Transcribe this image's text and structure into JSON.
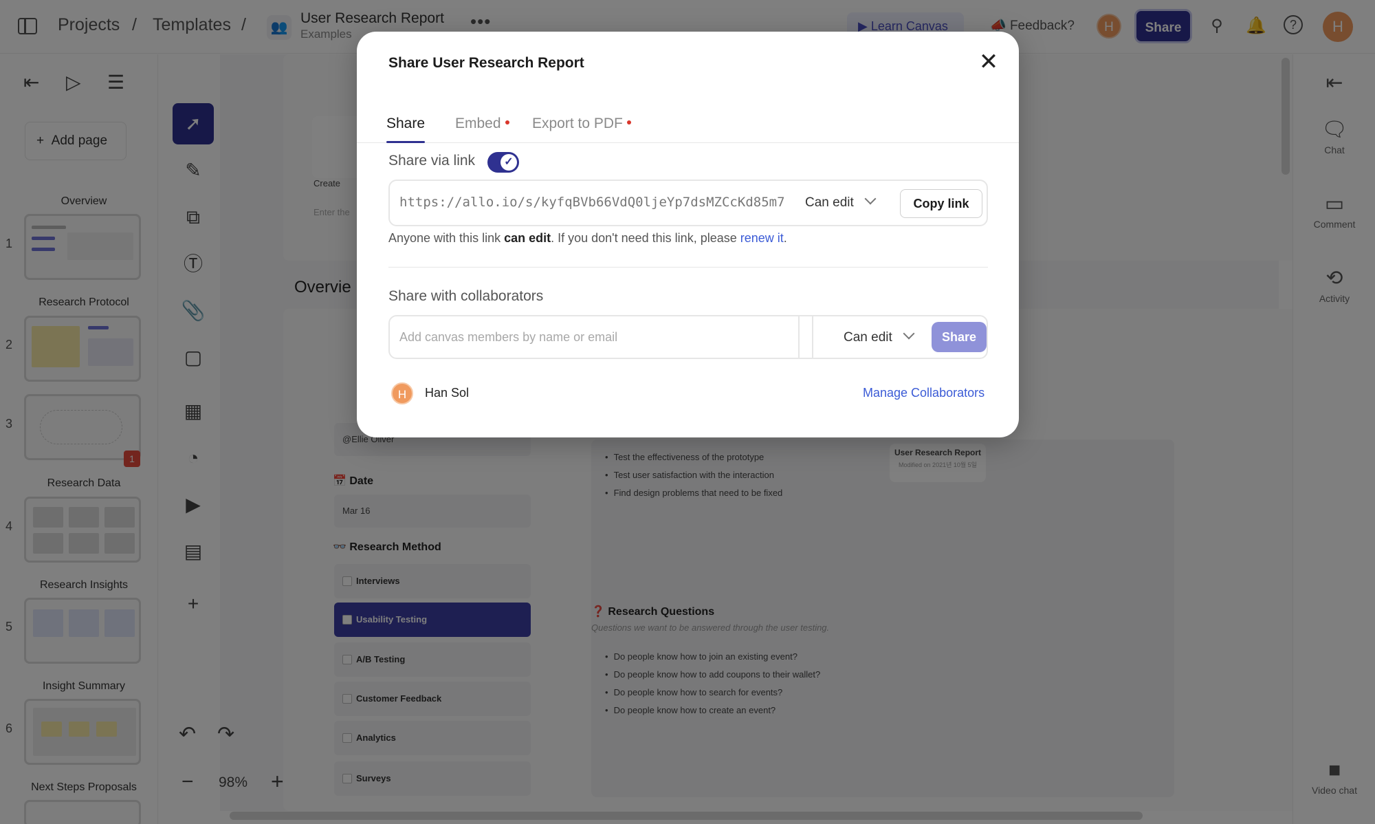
{
  "topbar": {
    "crumbs": [
      "Projects",
      "Templates"
    ],
    "separator": "/",
    "doc_icon": "👥",
    "doc_title": "User Research Report",
    "doc_subtitle": "Examples",
    "more": "•••",
    "learn_label": "Learn Canvas",
    "feedback_label": "Feedback?",
    "avatar_initial": "H",
    "share_label": "Share"
  },
  "sidebar": {
    "add_page_label": "Add page",
    "pages": [
      {
        "num": "1",
        "label": "Overview"
      },
      {
        "num": "2",
        "label": "Research Protocol"
      },
      {
        "num": "3",
        "label": ""
      },
      {
        "num": "4",
        "label": "Research Data"
      },
      {
        "num": "5",
        "label": "Research Insights"
      },
      {
        "num": "6",
        "label": "Insight Summary"
      },
      {
        "num": "",
        "label": "Next Steps Proposals"
      }
    ],
    "badge": "1"
  },
  "toolbar": {
    "zoom": "98%",
    "zoom_minus": "−",
    "zoom_plus": "+"
  },
  "canvas": {
    "overview_heading": "Overvie",
    "create_text": "Create",
    "enter_text": "Enter the",
    "owner_value": "@Ellie Oliver",
    "date_heading": "📅 Date",
    "date_value": "Mar 16",
    "method_heading": "👓 Research Method",
    "methods": [
      "Interviews",
      "Usability Testing",
      "A/B Testing",
      "Customer Feedback",
      "Analytics",
      "Surveys"
    ],
    "goals": [
      "Test the effectiveness of the prototype",
      "Test user satisfaction with the interaction",
      "Find design problems that need to be fixed"
    ],
    "report_card_title": "User Research Report",
    "report_card_sub": "Modified on 2021년 10월 5일",
    "questions_heading": "❓ Research Questions",
    "questions_sub": "Questions we want to be answered through the user testing.",
    "questions": [
      "Do people know how to join an existing event?",
      "Do people know how to add coupons to their wallet?",
      "Do people know how to search for events?",
      "Do people know how to create an event?"
    ]
  },
  "rightbar": {
    "items": [
      "Chat",
      "Comment",
      "Activity"
    ],
    "video_chat": "Video chat"
  },
  "modal": {
    "title": "Share User Research Report",
    "tabs": [
      "Share",
      "Embed",
      "Export to PDF"
    ],
    "share_via_link_label": "Share via link",
    "link_enabled": true,
    "link_url": "https://allo.io/s/kyfqBVb66VdQ0ljeYp7dsMZCcKd85m7)",
    "link_permission": "Can edit",
    "copy_link_label": "Copy link",
    "info_prefix": "Anyone with this link ",
    "info_bold": "can edit",
    "info_middle": ". If you don't need this link, please ",
    "info_link": "renew it",
    "info_suffix": ".",
    "collab_heading": "Share with collaborators",
    "collab_placeholder": "Add canvas members by name or email",
    "collab_permission": "Can edit",
    "collab_share_label": "Share",
    "member_initial": "H",
    "member_name": "Han Sol",
    "manage_label": "Manage Collaborators"
  },
  "colors": {
    "accent": "#2f3190",
    "share_button_muted": "#8f92d9",
    "link_blue": "#3b5bd6",
    "tab_dot": "#d9362b",
    "avatar": "#f09a5e"
  }
}
